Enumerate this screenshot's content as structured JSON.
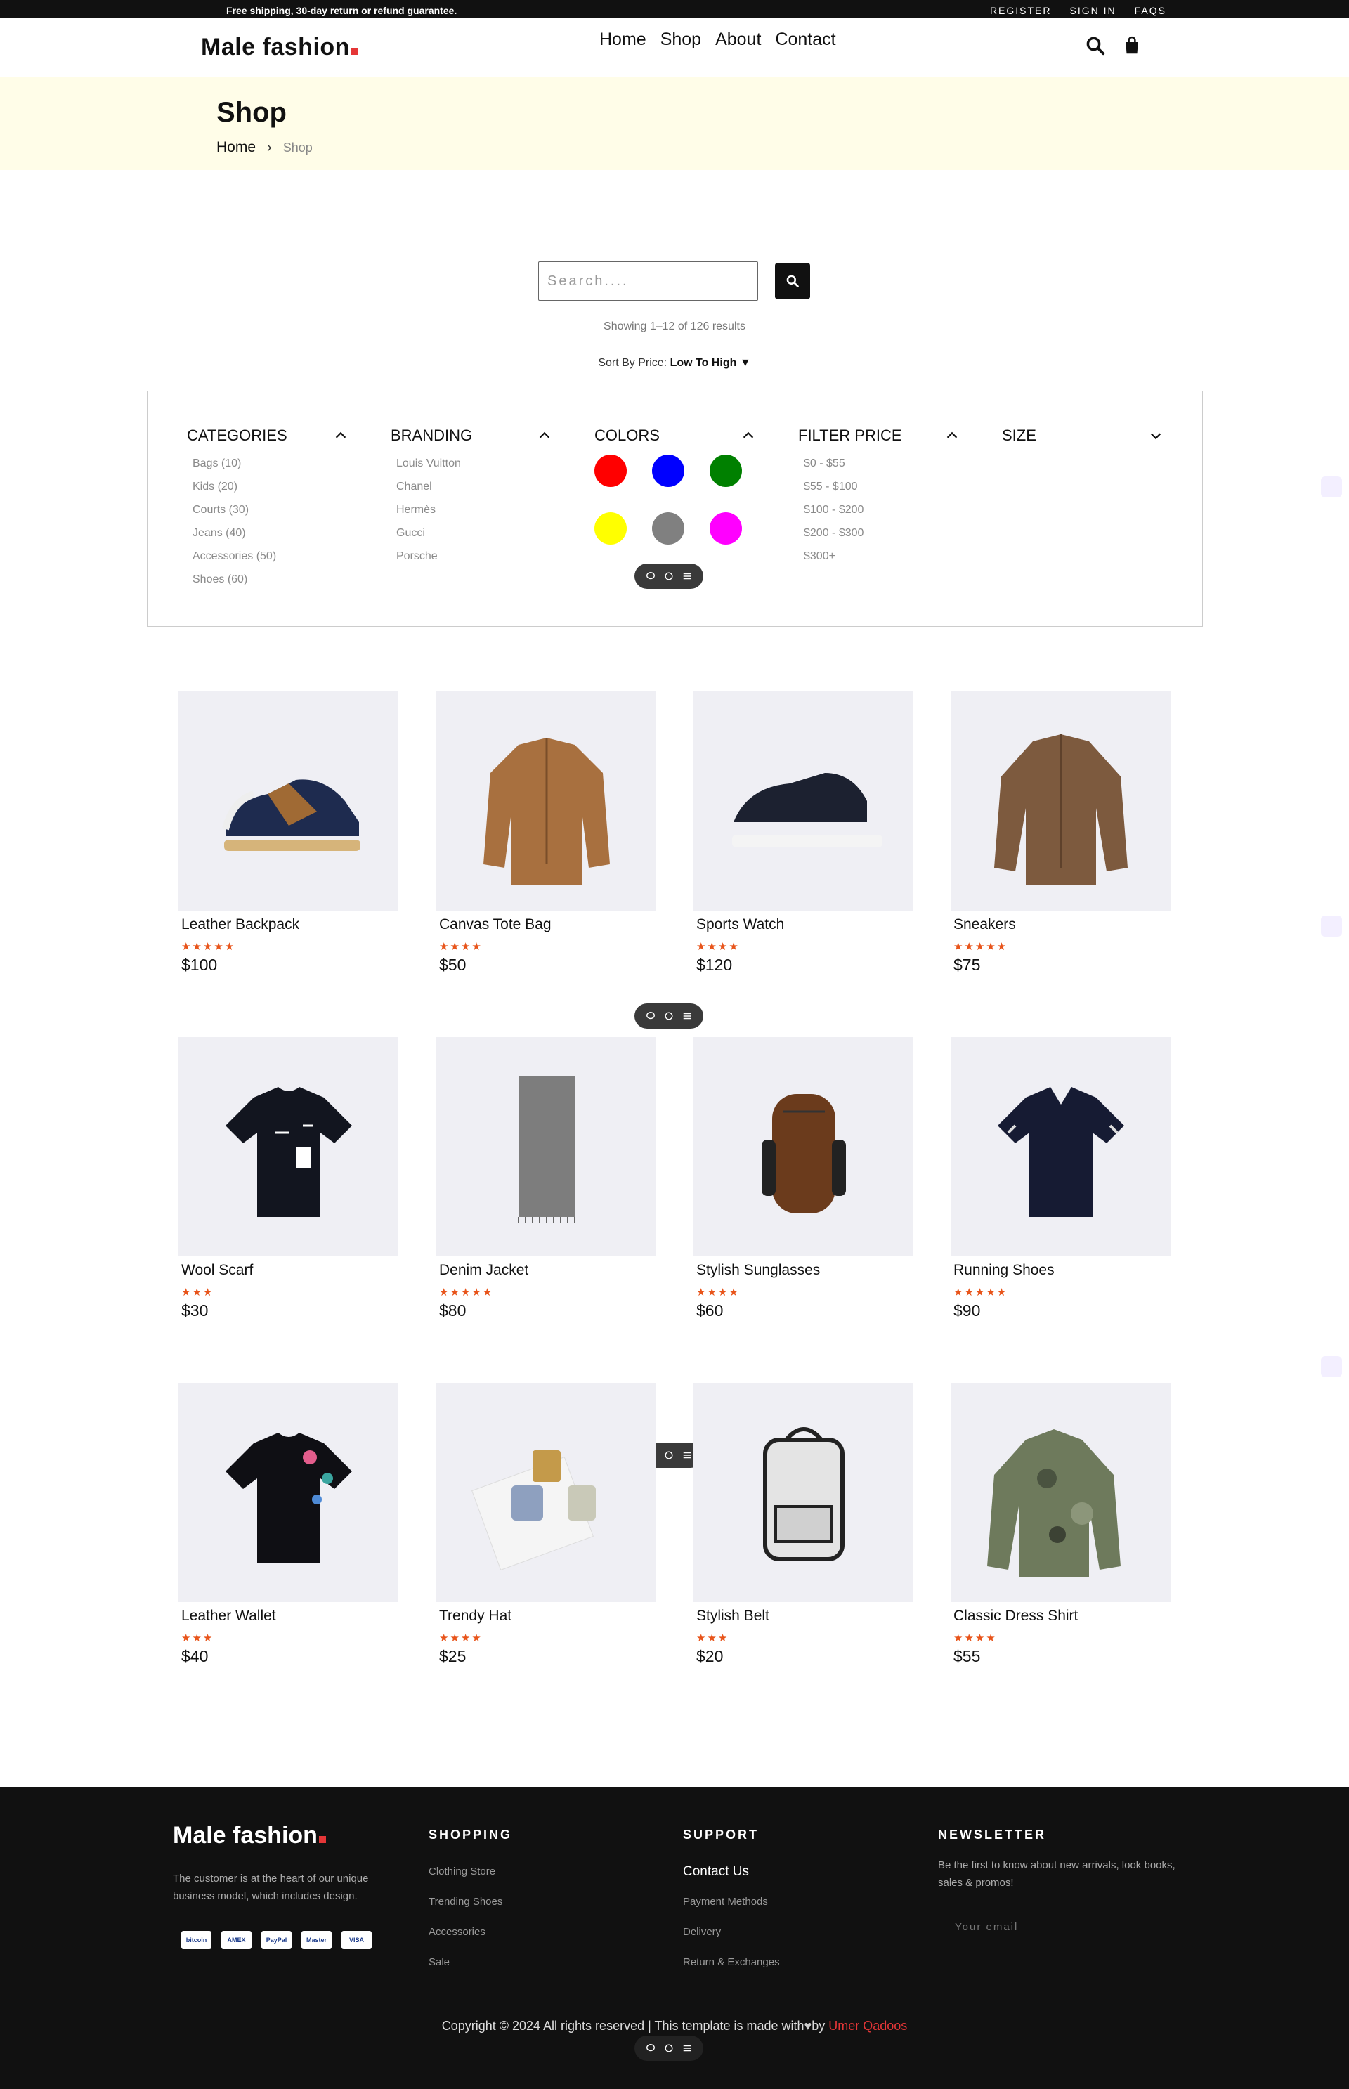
{
  "topbar": {
    "shipping": "Free shipping, 30-day return or refund guarantee.",
    "links": [
      "REGISTER",
      "SIGN IN",
      "FAQS"
    ]
  },
  "header": {
    "logo": "Male fashion",
    "nav": [
      "Home",
      "Shop",
      "About",
      "Contact"
    ],
    "icons": [
      "search-icon",
      "bag-icon"
    ]
  },
  "hero": {
    "title": "Shop",
    "crumb_home": "Home",
    "crumb_current": "Shop"
  },
  "search": {
    "placeholder": "Search....",
    "showing": "Showing 1–12 of 126 results",
    "sort_label": "Sort By Price:",
    "sort_value": "Low To High",
    "sort_arrow": "▼"
  },
  "filters": {
    "categories": {
      "title": "CATEGORIES",
      "items": [
        "Bags (10)",
        "Kids (20)",
        "Courts (30)",
        "Jeans (40)",
        "Accessories (50)",
        "Shoes (60)"
      ]
    },
    "branding": {
      "title": "BRANDING",
      "items": [
        "Louis Vuitton",
        "Chanel",
        "Hermès",
        "Gucci",
        "Porsche"
      ]
    },
    "colors": {
      "title": "COLORS",
      "swatches": [
        "#ff0000",
        "#0000ff",
        "#008000",
        "#ffff00",
        "#808080",
        "#ff00ff"
      ]
    },
    "price": {
      "title": "FILTER PRICE",
      "items": [
        "$0 - $55",
        "$55 - $100",
        "$100 - $200",
        "$200 - $300",
        "$300+"
      ]
    },
    "size": {
      "title": "SIZE"
    }
  },
  "products": [
    {
      "name": "Leather Backpack",
      "stars": "★★★★★",
      "rating": 5,
      "price": "$100",
      "image": "sneaker-blue"
    },
    {
      "name": "Canvas Tote Bag",
      "stars": "★★★★",
      "rating": 4,
      "price": "$50",
      "image": "jacket-tan"
    },
    {
      "name": "Sports Watch",
      "stars": "★★★★",
      "rating": 4,
      "price": "$120",
      "image": "sneaker-black"
    },
    {
      "name": "Sneakers",
      "stars": "★★★★★",
      "rating": 5,
      "price": "$75",
      "image": "shirt-brown"
    },
    {
      "name": "Wool Scarf",
      "stars": "★★★",
      "rating": 3,
      "price": "$30",
      "image": "tshirt-black-print"
    },
    {
      "name": "Denim Jacket",
      "stars": "★★★★★",
      "rating": 5,
      "price": "$80",
      "image": "scarf-grey"
    },
    {
      "name": "Stylish Sunglasses",
      "stars": "★★★★",
      "rating": 4,
      "price": "$60",
      "image": "backpack-brown"
    },
    {
      "name": "Running Shoes",
      "stars": "★★★★★",
      "rating": 5,
      "price": "$90",
      "image": "polo-navy"
    },
    {
      "name": "Leather Wallet",
      "stars": "★★★",
      "rating": 3,
      "price": "$40",
      "image": "tshirt-floral"
    },
    {
      "name": "Trendy Hat",
      "stars": "★★★★",
      "rating": 4,
      "price": "$25",
      "image": "perfume-set"
    },
    {
      "name": "Stylish Belt",
      "stars": "★★★",
      "rating": 3,
      "price": "$20",
      "image": "backpack-white"
    },
    {
      "name": "Classic Dress Shirt",
      "stars": "★★★★",
      "rating": 4,
      "price": "$55",
      "image": "jacket-camo"
    }
  ],
  "footer": {
    "logo": "Male fashion",
    "description": "The customer is at the heart of our unique business model, which includes design.",
    "payments": [
      "bitcoin",
      "AMEX",
      "PayPal",
      "Master",
      "VISA"
    ],
    "shopping": {
      "title": "SHOPPING",
      "links": [
        "Clothing Store",
        "Trending Shoes",
        "Accessories",
        "Sale"
      ]
    },
    "support": {
      "title": "SUPPORT",
      "links": [
        "Contact Us",
        "Payment Methods",
        "Delivery",
        "Return & Exchanges"
      ]
    },
    "newsletter": {
      "title": "NEWSLETTER",
      "description": "Be the first to know about new arrivals, look books, sales & promos!",
      "placeholder": "Your email"
    },
    "copyright": "Copyright © 2024 All rights reserved | This template is made with",
    "by": "by",
    "author": "Umer Qadoos"
  },
  "colors": {
    "accent": "#e53637",
    "star": "#e8541a",
    "dark": "#111111",
    "hero_bg": "#fffde8"
  }
}
